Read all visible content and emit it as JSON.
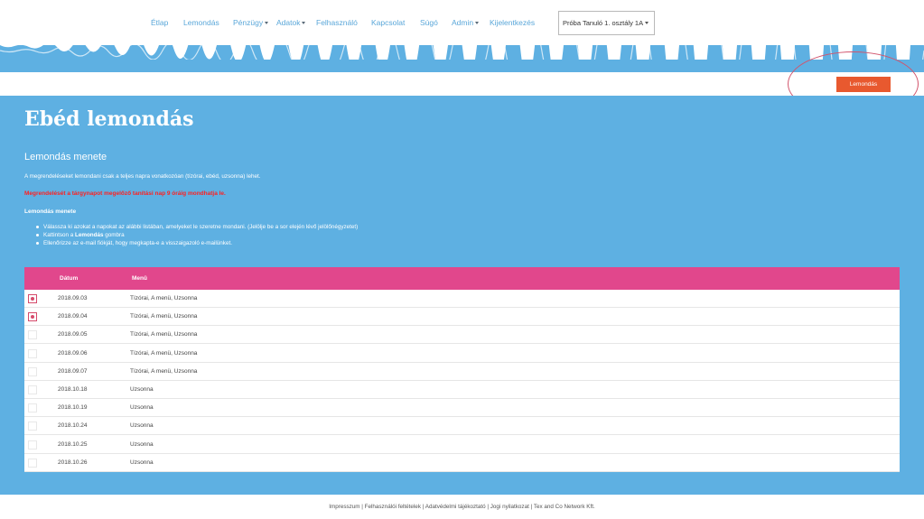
{
  "nav": {
    "items": [
      {
        "label": "Étlap",
        "dropdown": false
      },
      {
        "label": "Lemondás",
        "dropdown": false
      },
      {
        "label": "Pénzügy",
        "dropdown": true
      },
      {
        "label": "Adatok",
        "dropdown": true
      },
      {
        "label": "Felhasználó",
        "dropdown": false
      },
      {
        "label": "Kapcsolat",
        "dropdown": false
      },
      {
        "label": "Súgó",
        "dropdown": false
      },
      {
        "label": "Admin",
        "dropdown": true
      },
      {
        "label": "Kijelentkezés",
        "dropdown": false
      }
    ],
    "user_select": "Próba Tanuló 1. osztály 1A"
  },
  "action": {
    "cancel_button": "Lemondás"
  },
  "page": {
    "title": "Ebéd lemondás",
    "section_title": "Lemondás menete",
    "intro": "A megrendeléseket lemondani csak a teljes napra vonatkozóan (tízórai, ebéd, uzsonna) lehet.",
    "warning": "Megrendelését a tárgynapot megelőző tanítási nap 9 óráig mondhatja le.",
    "subhead": "Lemondás menete",
    "steps": [
      {
        "text": "Válassza ki azokat a napokat az alábbi listában, amelyeket le szeretne mondani. (Jelölje be a sor elején lévő jelölőnégyzetet)"
      },
      {
        "pre": "Kattintson a ",
        "bold": "Lemondás",
        "post": " gombra"
      },
      {
        "text": "Ellenőrizze az e-mail fiókját, hogy megkapta-e a visszaigazoló e-mailünket."
      }
    ]
  },
  "table": {
    "headers": {
      "date": "Dátum",
      "menu": "Menü"
    },
    "rows": [
      {
        "date": "2018.09.03",
        "menu": "Tízórai, A menü, Uzsonna",
        "checked": true
      },
      {
        "date": "2018.09.04",
        "menu": "Tízórai, A menü, Uzsonna",
        "checked": true
      },
      {
        "date": "2018.09.05",
        "menu": "Tízórai, A menü, Uzsonna",
        "checked": false
      },
      {
        "date": "2018.09.06",
        "menu": "Tízórai, A menü, Uzsonna",
        "checked": false
      },
      {
        "date": "2018.09.07",
        "menu": "Tízórai, A menü, Uzsonna",
        "checked": false
      },
      {
        "date": "2018.10.18",
        "menu": "Uzsonna",
        "checked": false
      },
      {
        "date": "2018.10.19",
        "menu": "Uzsonna",
        "checked": false
      },
      {
        "date": "2018.10.24",
        "menu": "Uzsonna",
        "checked": false
      },
      {
        "date": "2018.10.25",
        "menu": "Uzsonna",
        "checked": false
      },
      {
        "date": "2018.10.26",
        "menu": "Uzsonna",
        "checked": false
      }
    ]
  },
  "footer": {
    "links": [
      "Impresszum",
      "Felhasználói feltételek",
      "Adatvédelmi tájékoztató",
      "Jogi nyilatkozat",
      "Tex and Co Network Kft."
    ]
  },
  "colors": {
    "brand_blue": "#5eb0e2",
    "table_header_pink": "#e1478c",
    "button_orange": "#e8592f",
    "warning_red": "#ff2020",
    "nav_link": "#5aa7d9"
  }
}
